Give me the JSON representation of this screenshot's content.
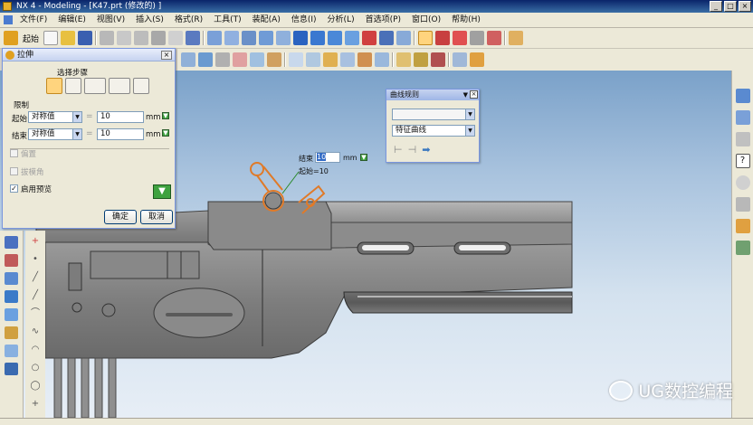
{
  "window": {
    "title": "NX 4 - Modeling - [K47.prt  (修改的) ]"
  },
  "menu": {
    "items": [
      "文件(F)",
      "编辑(E)",
      "视图(V)",
      "插入(S)",
      "格式(R)",
      "工具(T)",
      "装配(A)",
      "信息(I)",
      "分析(L)",
      "首选项(P)",
      "窗口(O)",
      "帮助(H)"
    ]
  },
  "toolbar": {
    "start_label": "起始"
  },
  "extrude_dialog": {
    "title": "拉伸",
    "section_label": "选择步骤",
    "limits_label": "限制",
    "start_label": "起始",
    "start_option": "对称值",
    "start_value": "10",
    "end_label": "结束",
    "end_option": "对称值",
    "end_value": "10",
    "unit": "mm",
    "option1": "偏置",
    "option2": "拔模角",
    "preview_label": "启用预览",
    "preview_checked": "✓",
    "ok_label": "确定",
    "cancel_label": "取消"
  },
  "curve_rule": {
    "title": "曲线规则",
    "selection": "",
    "rule": "特征曲线"
  },
  "inline_input": {
    "end_label": "结束",
    "value": "10",
    "unit": "mm",
    "start_readout": "起始=10"
  },
  "watermark": {
    "text": "UG数控编程"
  },
  "colors": {
    "selection_curve": "#e07a28",
    "body_gray": "#8a8a8a",
    "viewport_top": "#7aa1c9",
    "viewport_bottom": "#e7eef6"
  }
}
